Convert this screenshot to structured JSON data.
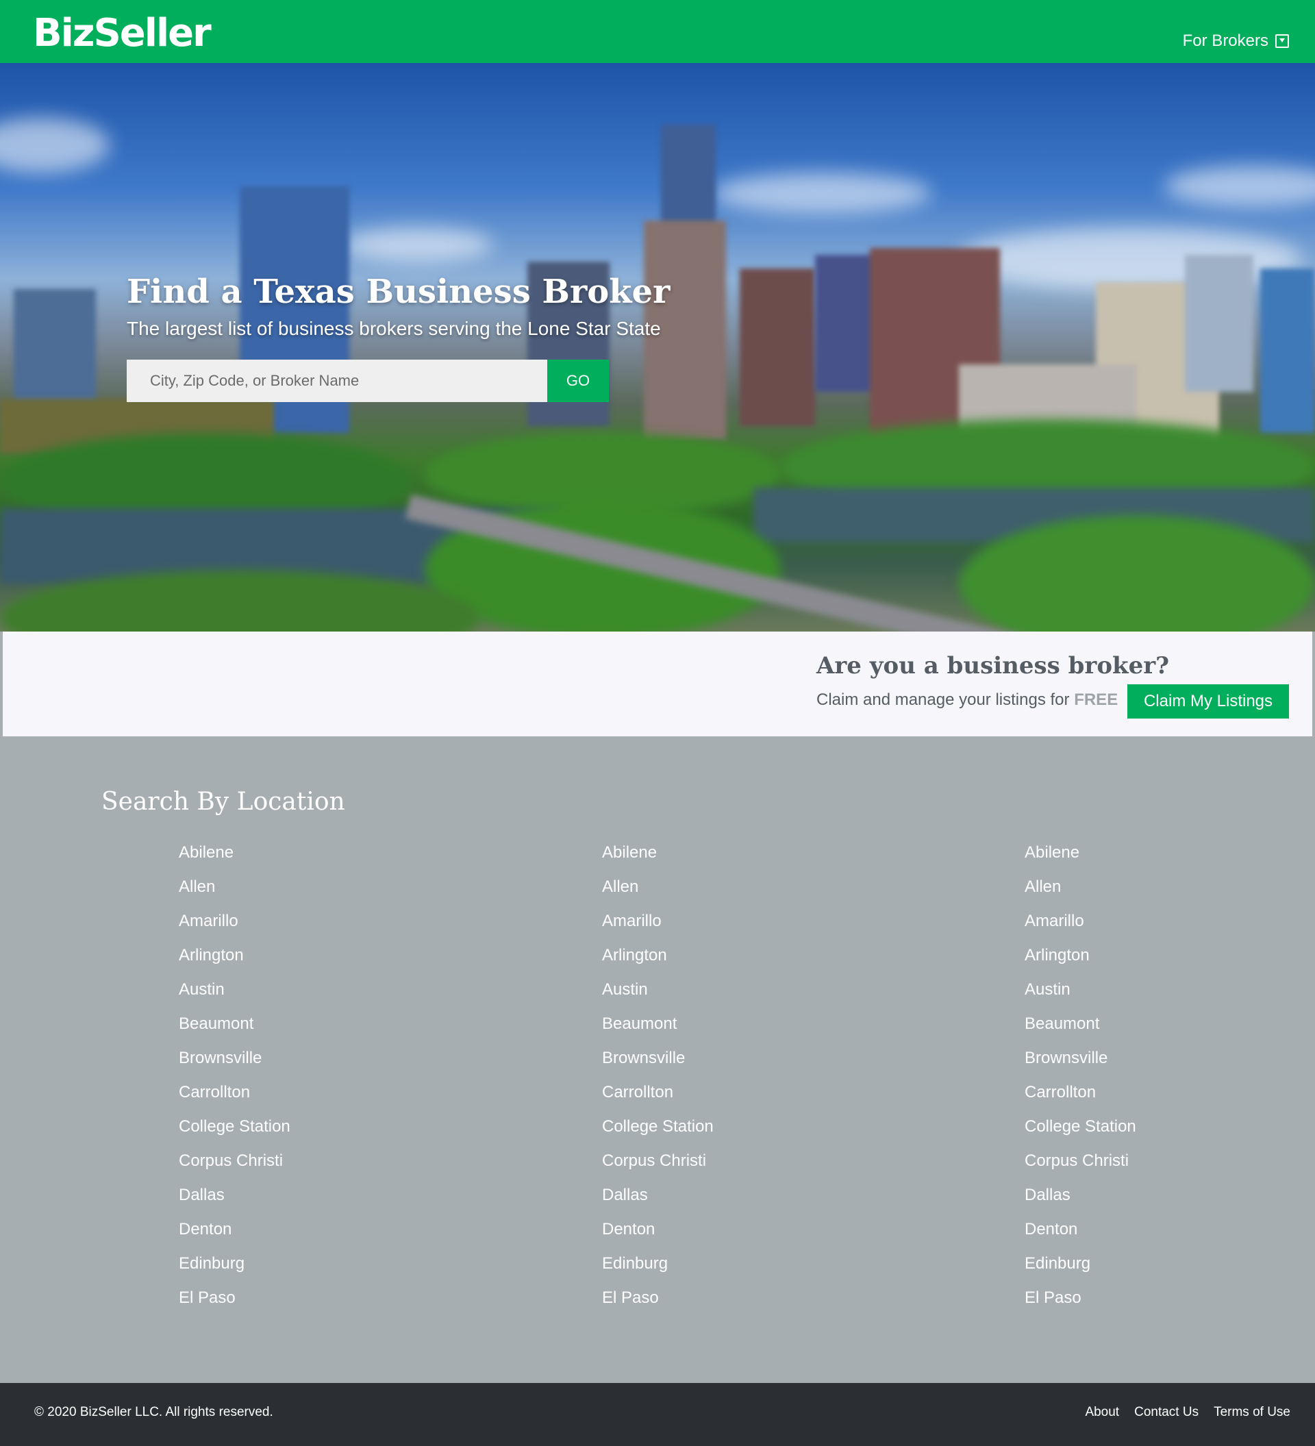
{
  "header": {
    "logo": "BizSeller",
    "for_brokers_label": "For Brokers",
    "for_brokers_icon": "dropdown-box-icon",
    "bg_color": "#00ae5b"
  },
  "hero": {
    "title": "Find a Texas Business Broker",
    "subtitle": "The largest list of business brokers serving the Lone Star State",
    "search_placeholder": "City, Zip Code, or Broker Name",
    "search_value": "",
    "go_label": "GO"
  },
  "broker_band": {
    "title": "Are you a business broker?",
    "text": "Claim and manage your listings for",
    "free": "FREE",
    "claim_label": "Claim My Listings"
  },
  "locations": {
    "title": "Search By Location",
    "columns": [
      [
        "Abilene",
        "Allen",
        "Amarillo",
        "Arlington",
        "Austin",
        "Beaumont",
        "Brownsville",
        "Carrollton",
        "College Station",
        "Corpus Christi",
        "Dallas",
        "Denton",
        "Edinburg",
        "El Paso"
      ],
      [
        "Abilene",
        "Allen",
        "Amarillo",
        "Arlington",
        "Austin",
        "Beaumont",
        "Brownsville",
        "Carrollton",
        "College Station",
        "Corpus Christi",
        "Dallas",
        "Denton",
        "Edinburg",
        "El Paso"
      ],
      [
        "Abilene",
        "Allen",
        "Amarillo",
        "Arlington",
        "Austin",
        "Beaumont",
        "Brownsville",
        "Carrollton",
        "College Station",
        "Corpus Christi",
        "Dallas",
        "Denton",
        "Edinburg",
        "El Paso"
      ]
    ]
  },
  "footer": {
    "copyright": "© 2020 BizSeller LLC. All rights reserved.",
    "links": [
      "About",
      "Contact Us",
      "Terms of Use"
    ]
  },
  "colors": {
    "accent": "#00ae5b",
    "section_bg": "#a6aeb1",
    "footer_bg": "#2b2f33"
  }
}
